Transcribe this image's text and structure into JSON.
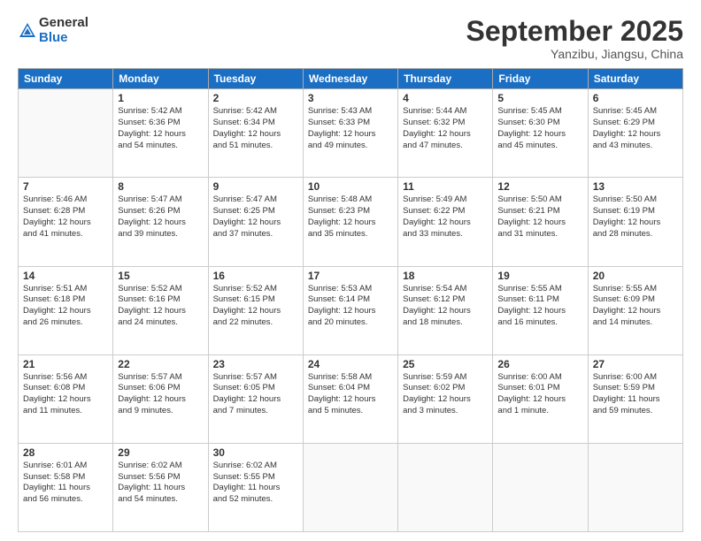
{
  "header": {
    "logo_general": "General",
    "logo_blue": "Blue",
    "month": "September 2025",
    "location": "Yanzibu, Jiangsu, China"
  },
  "days_of_week": [
    "Sunday",
    "Monday",
    "Tuesday",
    "Wednesday",
    "Thursday",
    "Friday",
    "Saturday"
  ],
  "weeks": [
    [
      {
        "num": "",
        "info": ""
      },
      {
        "num": "1",
        "info": "Sunrise: 5:42 AM\nSunset: 6:36 PM\nDaylight: 12 hours\nand 54 minutes."
      },
      {
        "num": "2",
        "info": "Sunrise: 5:42 AM\nSunset: 6:34 PM\nDaylight: 12 hours\nand 51 minutes."
      },
      {
        "num": "3",
        "info": "Sunrise: 5:43 AM\nSunset: 6:33 PM\nDaylight: 12 hours\nand 49 minutes."
      },
      {
        "num": "4",
        "info": "Sunrise: 5:44 AM\nSunset: 6:32 PM\nDaylight: 12 hours\nand 47 minutes."
      },
      {
        "num": "5",
        "info": "Sunrise: 5:45 AM\nSunset: 6:30 PM\nDaylight: 12 hours\nand 45 minutes."
      },
      {
        "num": "6",
        "info": "Sunrise: 5:45 AM\nSunset: 6:29 PM\nDaylight: 12 hours\nand 43 minutes."
      }
    ],
    [
      {
        "num": "7",
        "info": "Sunrise: 5:46 AM\nSunset: 6:28 PM\nDaylight: 12 hours\nand 41 minutes."
      },
      {
        "num": "8",
        "info": "Sunrise: 5:47 AM\nSunset: 6:26 PM\nDaylight: 12 hours\nand 39 minutes."
      },
      {
        "num": "9",
        "info": "Sunrise: 5:47 AM\nSunset: 6:25 PM\nDaylight: 12 hours\nand 37 minutes."
      },
      {
        "num": "10",
        "info": "Sunrise: 5:48 AM\nSunset: 6:23 PM\nDaylight: 12 hours\nand 35 minutes."
      },
      {
        "num": "11",
        "info": "Sunrise: 5:49 AM\nSunset: 6:22 PM\nDaylight: 12 hours\nand 33 minutes."
      },
      {
        "num": "12",
        "info": "Sunrise: 5:50 AM\nSunset: 6:21 PM\nDaylight: 12 hours\nand 31 minutes."
      },
      {
        "num": "13",
        "info": "Sunrise: 5:50 AM\nSunset: 6:19 PM\nDaylight: 12 hours\nand 28 minutes."
      }
    ],
    [
      {
        "num": "14",
        "info": "Sunrise: 5:51 AM\nSunset: 6:18 PM\nDaylight: 12 hours\nand 26 minutes."
      },
      {
        "num": "15",
        "info": "Sunrise: 5:52 AM\nSunset: 6:16 PM\nDaylight: 12 hours\nand 24 minutes."
      },
      {
        "num": "16",
        "info": "Sunrise: 5:52 AM\nSunset: 6:15 PM\nDaylight: 12 hours\nand 22 minutes."
      },
      {
        "num": "17",
        "info": "Sunrise: 5:53 AM\nSunset: 6:14 PM\nDaylight: 12 hours\nand 20 minutes."
      },
      {
        "num": "18",
        "info": "Sunrise: 5:54 AM\nSunset: 6:12 PM\nDaylight: 12 hours\nand 18 minutes."
      },
      {
        "num": "19",
        "info": "Sunrise: 5:55 AM\nSunset: 6:11 PM\nDaylight: 12 hours\nand 16 minutes."
      },
      {
        "num": "20",
        "info": "Sunrise: 5:55 AM\nSunset: 6:09 PM\nDaylight: 12 hours\nand 14 minutes."
      }
    ],
    [
      {
        "num": "21",
        "info": "Sunrise: 5:56 AM\nSunset: 6:08 PM\nDaylight: 12 hours\nand 11 minutes."
      },
      {
        "num": "22",
        "info": "Sunrise: 5:57 AM\nSunset: 6:06 PM\nDaylight: 12 hours\nand 9 minutes."
      },
      {
        "num": "23",
        "info": "Sunrise: 5:57 AM\nSunset: 6:05 PM\nDaylight: 12 hours\nand 7 minutes."
      },
      {
        "num": "24",
        "info": "Sunrise: 5:58 AM\nSunset: 6:04 PM\nDaylight: 12 hours\nand 5 minutes."
      },
      {
        "num": "25",
        "info": "Sunrise: 5:59 AM\nSunset: 6:02 PM\nDaylight: 12 hours\nand 3 minutes."
      },
      {
        "num": "26",
        "info": "Sunrise: 6:00 AM\nSunset: 6:01 PM\nDaylight: 12 hours\nand 1 minute."
      },
      {
        "num": "27",
        "info": "Sunrise: 6:00 AM\nSunset: 5:59 PM\nDaylight: 11 hours\nand 59 minutes."
      }
    ],
    [
      {
        "num": "28",
        "info": "Sunrise: 6:01 AM\nSunset: 5:58 PM\nDaylight: 11 hours\nand 56 minutes."
      },
      {
        "num": "29",
        "info": "Sunrise: 6:02 AM\nSunset: 5:56 PM\nDaylight: 11 hours\nand 54 minutes."
      },
      {
        "num": "30",
        "info": "Sunrise: 6:02 AM\nSunset: 5:55 PM\nDaylight: 11 hours\nand 52 minutes."
      },
      {
        "num": "",
        "info": ""
      },
      {
        "num": "",
        "info": ""
      },
      {
        "num": "",
        "info": ""
      },
      {
        "num": "",
        "info": ""
      }
    ]
  ]
}
